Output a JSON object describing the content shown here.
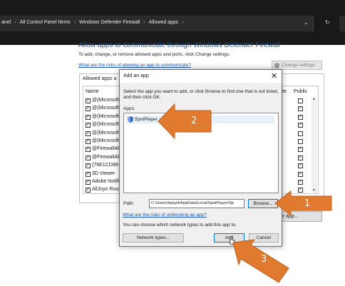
{
  "address_bar": {
    "crumbs": [
      "anel",
      "All Control Panel Items",
      "Windows Defender Firewall",
      "Allowed apps"
    ],
    "separator": "›",
    "dropdown_glyph": "⌄",
    "refresh_glyph": "↻"
  },
  "main": {
    "title": "Allow apps to communicate through Windows Defender Firewall",
    "subtitle": "To add, change, or remove allowed apps and ports, click Change settings.",
    "risk_link": "What are the risks of allowing an app to communicate?",
    "change_settings_label": "Change settings",
    "allowed_label": "Allowed apps a",
    "col_name": "Name",
    "col_private": "te",
    "col_public": "Public",
    "rows": [
      {
        "name": "@{Microsoft",
        "checked": "✓",
        "public": ""
      },
      {
        "name": "@{Microsoft",
        "checked": "✓",
        "public": "✓"
      },
      {
        "name": "@{Microsoft",
        "checked": "✓",
        "public": "✓"
      },
      {
        "name": "@{Microsoft",
        "checked": "✓",
        "public": "✓"
      },
      {
        "name": "@{Microsoft",
        "checked": "✓",
        "public": ""
      },
      {
        "name": "@{Microsoft",
        "checked": "✓",
        "public": ""
      },
      {
        "name": "@FirewallAP",
        "checked": "✓",
        "public": "✓"
      },
      {
        "name": "@FirewallAP",
        "checked": "✓",
        "public": "✓"
      },
      {
        "name": "{78E1CD88-4",
        "checked": "✓",
        "public": "✓"
      },
      {
        "name": "3D Viewer",
        "checked": "✓",
        "public": "✓"
      },
      {
        "name": "Adobe Notifi",
        "checked": "✓",
        "public": "✓"
      },
      {
        "name": "AllJoyn Rout",
        "checked": "✓",
        "public": "✓"
      }
    ],
    "allow_another_label": "ther app..."
  },
  "dialog": {
    "title": "Add an app",
    "close_glyph": "✕",
    "description": "Select the app you want to add, or click Browse to find one that is not listed, and then click OK.",
    "apps_label": "Apps:",
    "apps": [
      {
        "label": "SpotPlayer"
      }
    ],
    "path_label": "Path:",
    "path_value": "C:\\Users\\hpayd\\AppData\\Local\\SpotPlayer\\Sp",
    "browse_label": "Browse...",
    "risk_link": "What are the risks of unblocking an app?",
    "network_text": "You can choose which network types to add this app to.",
    "network_types_label": "Network types...",
    "add_label": "Add",
    "cancel_label": "Cancel"
  },
  "annotations": {
    "color": "#e07a2e",
    "labels": [
      "1",
      "2",
      "3"
    ]
  }
}
